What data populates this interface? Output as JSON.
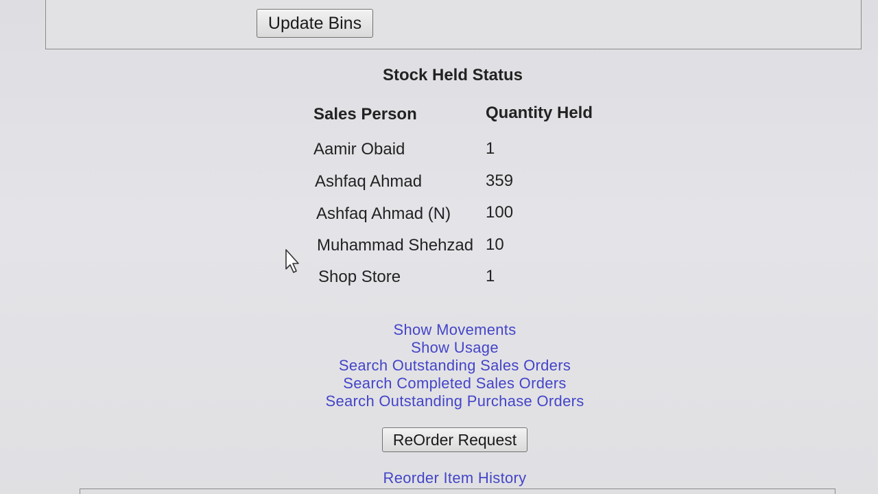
{
  "toolbar": {
    "update_bins_label": "Update Bins"
  },
  "stock_status": {
    "title": "Stock Held Status",
    "columns": [
      "Sales Person",
      "Quantity Held"
    ],
    "rows": [
      {
        "sales_person": "Aamir Obaid",
        "quantity": "1"
      },
      {
        "sales_person": "Ashfaq Ahmad",
        "quantity": "359"
      },
      {
        "sales_person": "Ashfaq Ahmad (N)",
        "quantity": "100"
      },
      {
        "sales_person": "Muhammad Shehzad",
        "quantity": "10"
      },
      {
        "sales_person": "Shop Store",
        "quantity": "1"
      }
    ]
  },
  "links": [
    "Show Movements",
    "Show Usage",
    "Search Outstanding Sales Orders",
    "Search Completed Sales Orders",
    "Search Outstanding Purchase Orders"
  ],
  "reorder": {
    "button_label": "ReOrder Request",
    "history_link": "Reorder Item History"
  },
  "colors": {
    "link": "#4444c8",
    "background": "#e0e0e3"
  },
  "icons": {
    "cursor": "mouse-pointer-icon"
  }
}
